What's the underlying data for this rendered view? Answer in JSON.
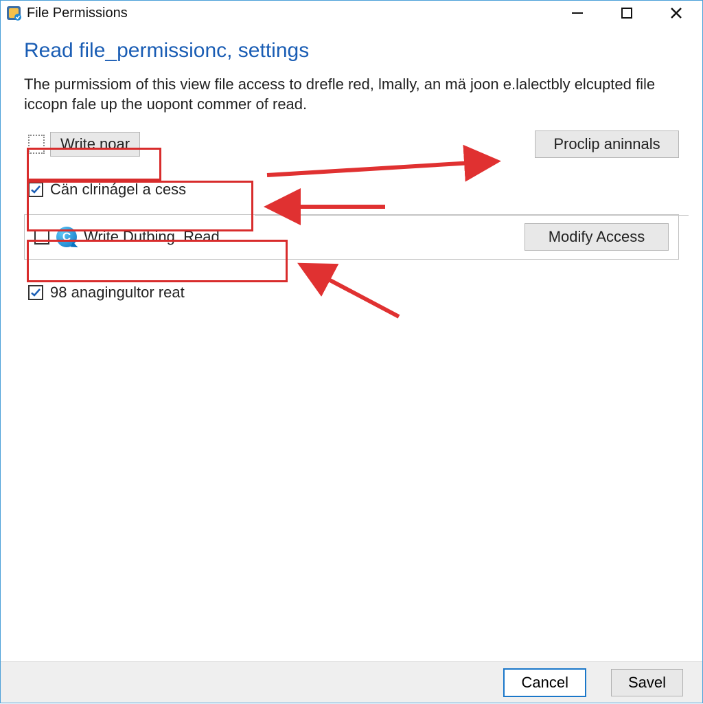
{
  "titlebar": {
    "title": "File Permissions"
  },
  "heading": "Read file_permissionc, settings",
  "description": "The purmissiom of this view file access to drefle red, lmally, an mä joon e.lalectbly elcupted file iccopn fale up the uopont commer of read.",
  "row1": {
    "write_label": "Write noar",
    "right_btn": "Proclip aninnals"
  },
  "row2": {
    "checkbox_label": "Cän clrinágel a cess"
  },
  "row3": {
    "c_letter": "C",
    "label": "Write Dutbing. Read",
    "modify_btn": "Modify Access"
  },
  "row4": {
    "checkbox_label": "98 anagingultor reat"
  },
  "footer": {
    "cancel": "Cancel",
    "save": "Savel"
  },
  "annotations": {
    "highlight_color": "#d82c2c",
    "arrow_color": "#e03131"
  }
}
